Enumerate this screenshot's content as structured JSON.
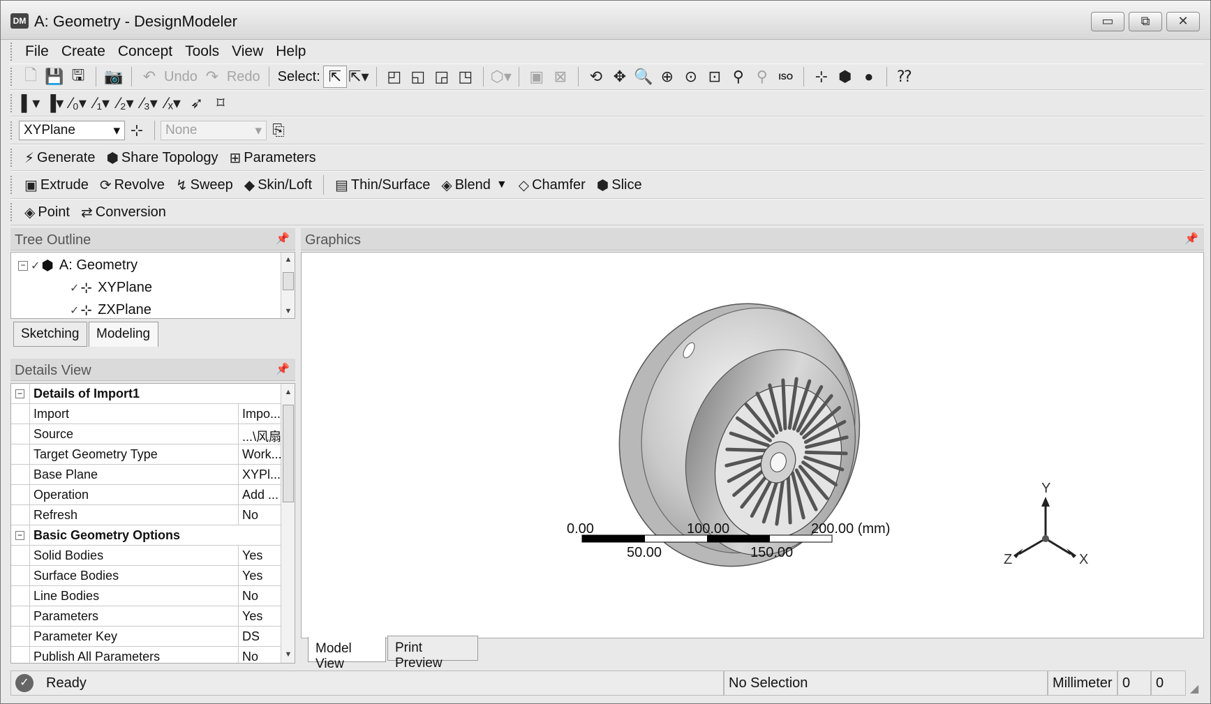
{
  "window": {
    "title": "A: Geometry - DesignModeler",
    "app_icon": "DM",
    "minimize": "▭",
    "maximize": "⧉",
    "close": "✕"
  },
  "menu": [
    "File",
    "Create",
    "Concept",
    "Tools",
    "View",
    "Help"
  ],
  "toolbar1": {
    "undo": "Undo",
    "redo": "Redo",
    "select_label": "Select:"
  },
  "toolbar3": {
    "plane": "XYPlane",
    "sketch": "None"
  },
  "toolbar4": {
    "generate": "Generate",
    "share_topology": "Share Topology",
    "parameters": "Parameters"
  },
  "toolbar5": {
    "extrude": "Extrude",
    "revolve": "Revolve",
    "sweep": "Sweep",
    "skin_loft": "Skin/Loft",
    "thin_surface": "Thin/Surface",
    "blend": "Blend",
    "chamfer": "Chamfer",
    "slice": "Slice"
  },
  "toolbar6": {
    "point": "Point",
    "conversion": "Conversion"
  },
  "tree_outline": {
    "title": "Tree Outline",
    "items": [
      {
        "label": "A: Geometry",
        "icon": "geometry-icon"
      },
      {
        "label": "XYPlane",
        "icon": "plane-icon"
      },
      {
        "label": "ZXPlane",
        "icon": "plane-icon"
      }
    ],
    "tabs": [
      "Sketching",
      "Modeling"
    ],
    "active_tab": "Modeling"
  },
  "details_view": {
    "title": "Details View",
    "groups": [
      {
        "name": "Details of Import1",
        "rows": [
          {
            "key": "Import",
            "value": "Impo..."
          },
          {
            "key": "Source",
            "value": "...\\风扇"
          },
          {
            "key": "Target Geometry Type",
            "value": "Work..."
          },
          {
            "key": "Base Plane",
            "value": "XYPl..."
          },
          {
            "key": "Operation",
            "value": "Add ..."
          },
          {
            "key": "Refresh",
            "value": "No"
          }
        ]
      },
      {
        "name": "Basic Geometry Options",
        "rows": [
          {
            "key": "Solid Bodies",
            "value": "Yes"
          },
          {
            "key": "Surface Bodies",
            "value": "Yes"
          },
          {
            "key": "Line Bodies",
            "value": "No"
          },
          {
            "key": "Parameters",
            "value": "Yes"
          },
          {
            "key": "Parameter Key",
            "value": "DS"
          },
          {
            "key": "Publish All Parameters",
            "value": "No"
          }
        ]
      }
    ]
  },
  "graphics": {
    "title": "Graphics",
    "scale_top": [
      "0.00",
      "100.00",
      "200.00 (mm)"
    ],
    "scale_bottom": [
      "50.00",
      "150.00"
    ],
    "triad": {
      "x": "X",
      "y": "Y",
      "z": "Z"
    },
    "tabs": [
      "Model View",
      "Print Preview"
    ],
    "active_tab": "Model View"
  },
  "status": {
    "message": "Ready",
    "selection": "No Selection",
    "units": "Millimeter",
    "coord1": "0",
    "coord2": "0"
  }
}
